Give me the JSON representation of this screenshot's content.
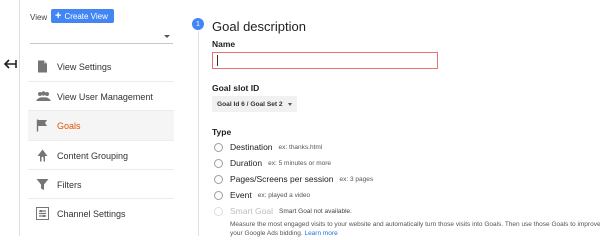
{
  "header": {
    "view_label": "View",
    "create_view_label": "Create View"
  },
  "sidebar": {
    "items": [
      {
        "label": "View Settings",
        "icon": "document-icon",
        "active": false
      },
      {
        "label": "View User Management",
        "icon": "people-icon",
        "active": false
      },
      {
        "label": "Goals",
        "icon": "flag-icon",
        "active": true
      },
      {
        "label": "Content Grouping",
        "icon": "person-walking-icon",
        "active": false
      },
      {
        "label": "Filters",
        "icon": "filter-icon",
        "active": false
      },
      {
        "label": "Channel Settings",
        "icon": "channel-settings-icon",
        "active": false
      }
    ]
  },
  "main": {
    "step_number": "1",
    "section_title": "Goal description",
    "name_label": "Name",
    "name_value": "",
    "slot_label": "Goal slot ID",
    "slot_value": "Goal Id 6 / Goal Set 2",
    "type_label": "Type",
    "types": [
      {
        "label": "Destination",
        "example": "ex: thanks.html"
      },
      {
        "label": "Duration",
        "example": "ex: 5 minutes or more"
      },
      {
        "label": "Pages/Screens per session",
        "example": "ex: 3 pages"
      },
      {
        "label": "Event",
        "example": "ex: played a video"
      },
      {
        "label": "Smart Goal",
        "example": "Smart Goal not available."
      }
    ],
    "smart_goal_description": "Measure the most engaged visits to your website and automatically turn those visits into Goals. Then use those Goals to improve your Google Ads bidding.",
    "learn_more": "Learn more"
  },
  "colors": {
    "accent": "#4285f4",
    "active_nav": "#e65100",
    "input_error_border": "#e57373",
    "link": "#1a73e8"
  }
}
